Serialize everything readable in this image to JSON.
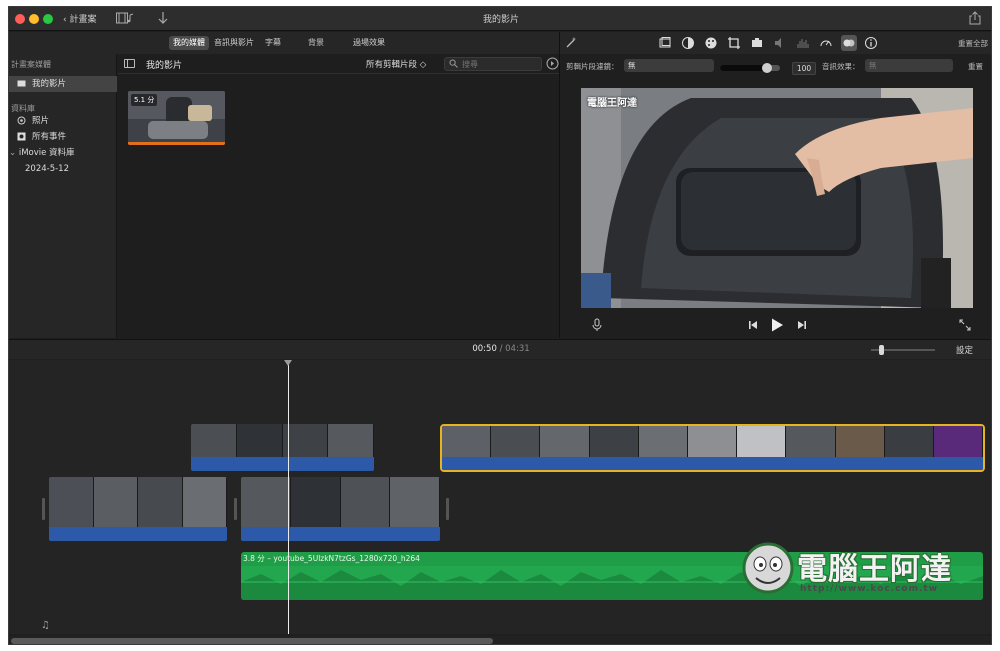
{
  "titlebar": {
    "back_label": "計畫案",
    "title": "我的影片"
  },
  "library_tabs": [
    "我的媒體",
    "音訊與影片",
    "字幕",
    "背景",
    "過場效果"
  ],
  "sidebar": {
    "projects_heading": "計畫案媒體",
    "project_item": "我的影片",
    "libraries_heading": "資料庫",
    "items": [
      "照片",
      "所有事件"
    ],
    "library_name": "iMovie 資料庫",
    "event_date": "2024-5-12"
  },
  "browser": {
    "title": "我的影片",
    "filter_label": "所有剪輯片段 ◇",
    "search_placeholder": "搜尋",
    "thumb_duration": "5.1 分"
  },
  "viewer": {
    "reset_all": "重置全部",
    "clip_filter_label": "剪輯片段濾鏡：",
    "clip_filter_value": "無",
    "volume_value": "100",
    "audio_effect_label": "音訊效果：",
    "audio_effect_value": "無",
    "reset": "重置",
    "video_watermark": "電腦王阿達",
    "volume_level": 0.78
  },
  "timeline": {
    "current_time": "00:50",
    "separator": "/",
    "duration": "04:31",
    "settings_label": "設定",
    "audio_clip_label": "3.8 分 – youtube_5UlzkN7tzGs_1280x720_h264"
  },
  "watermark": {
    "text": "電腦王阿達",
    "url": "http://www.koc.com.tw"
  },
  "colors": {
    "accent": "#e6b422",
    "audio_blue": "#2d5aa8",
    "audio_green": "#1f9d47"
  }
}
